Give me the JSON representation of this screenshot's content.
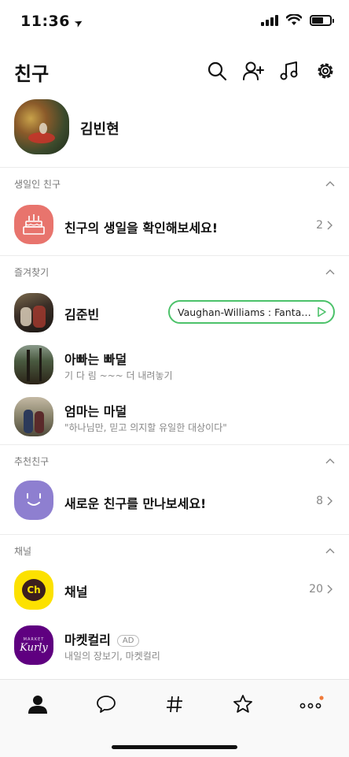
{
  "status_bar": {
    "time": "11:36"
  },
  "header": {
    "title": "친구"
  },
  "profile": {
    "name": "김빈현"
  },
  "sections": {
    "birthday": {
      "title": "생일인 친구",
      "row_title": "친구의 생일을 확인해보세요!",
      "count": "2"
    },
    "favorites": {
      "title": "즐겨찾기",
      "items": [
        {
          "name": "김준빈",
          "music": "Vaughan-Williams : Fantasi..."
        },
        {
          "name": "아빠는 빠덜",
          "status": "기 다 림  ~~~ 더 내려놓기"
        },
        {
          "name": "엄마는 마덜",
          "status": "\"하나님만, 믿고 의지할 유일한 대상이다\""
        }
      ]
    },
    "recommend": {
      "title": "추천친구",
      "row_title": "새로운 친구를 만나보세요!",
      "count": "8"
    },
    "channel": {
      "title": "채널",
      "channel_row": {
        "title": "채널",
        "count": "20",
        "icon_text": "Ch"
      },
      "ad_row": {
        "title": "마켓컬리",
        "badge": "AD",
        "sub": "내일의 장보기, 마켓컬리",
        "logo_top": "MARKET",
        "logo": "Kurly"
      }
    }
  },
  "colors": {
    "accent_green": "#4cc26a",
    "birthday_red": "#e8746d",
    "recommend_purple": "#8e7fd0",
    "channel_yellow": "#fce100",
    "kurly_purple": "#5f0080",
    "notification_dot": "#f07a3a"
  },
  "icons": {
    "header": [
      "search-icon",
      "add-friend-icon",
      "music-icon",
      "settings-icon"
    ],
    "tabs": [
      "friends-icon",
      "chat-icon",
      "hashtag-icon",
      "star-icon",
      "more-icon"
    ]
  }
}
